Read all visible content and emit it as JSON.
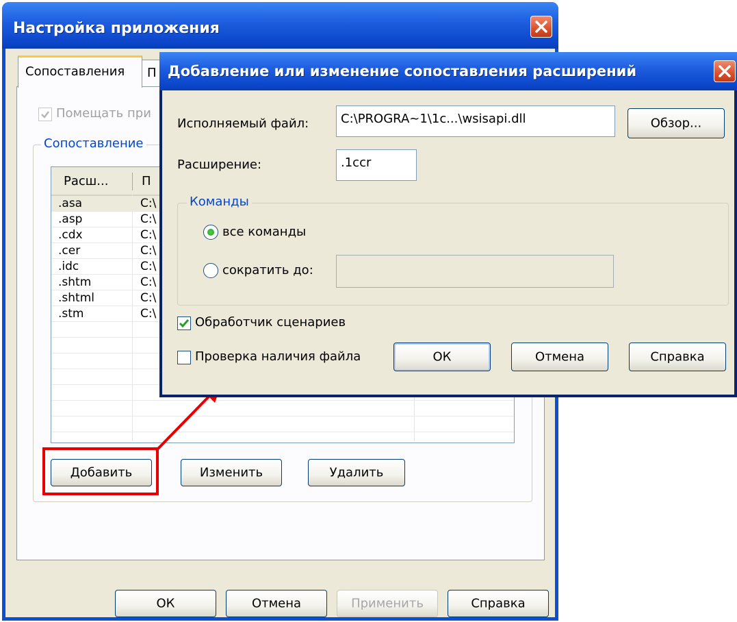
{
  "back_window": {
    "title": "Настройка приложения",
    "tabs": [
      {
        "label": "Сопоставления",
        "active": true
      },
      {
        "label": "П",
        "active": false
      }
    ],
    "checkbox_put": {
      "label": "Помещать при",
      "checked": true,
      "disabled": true
    },
    "group_label": "Сопоставление",
    "list": {
      "columns": [
        "Расш...",
        "П"
      ],
      "rows": [
        {
          "ext": ".asa",
          "path": "C:\\"
        },
        {
          "ext": ".asp",
          "path": "C:\\"
        },
        {
          "ext": ".cdx",
          "path": "C:\\"
        },
        {
          "ext": ".cer",
          "path": "C:\\"
        },
        {
          "ext": ".idc",
          "path": "C:\\"
        },
        {
          "ext": ".shtm",
          "path": "C:\\"
        },
        {
          "ext": ".shtml",
          "path": "C:\\"
        },
        {
          "ext": ".stm",
          "path": "C:\\"
        }
      ]
    },
    "buttons": {
      "add": "Добавить",
      "edit": "Изменить",
      "delete": "Удалить"
    },
    "footer": {
      "ok": "ОК",
      "cancel": "Отмена",
      "apply": "Применить",
      "help": "Справка"
    }
  },
  "dialog": {
    "title": "Добавление или изменение сопоставления расширений",
    "exec_label": "Исполняемый файл:",
    "exec_value": "C:\\PROGRA~1\\1c...\\wsisapi.dll",
    "browse": "Обзор...",
    "ext_label": "Расширение:",
    "ext_value": ".1ccr",
    "commands_group": "Команды",
    "radio_all": "все команды",
    "radio_limit": "сократить до:",
    "limit_value": "",
    "script_handler": {
      "label": "Обработчик сценариев",
      "checked": true
    },
    "check_file": {
      "label": "Проверка наличия файла",
      "checked": false
    },
    "ok": "ОК",
    "cancel": "Отмена",
    "help": "Справка"
  },
  "colors": {
    "title_bar": "#0a44c8",
    "window_face": "#ece9d8",
    "highlight": "#e80000",
    "group_label": "#0046d5"
  }
}
